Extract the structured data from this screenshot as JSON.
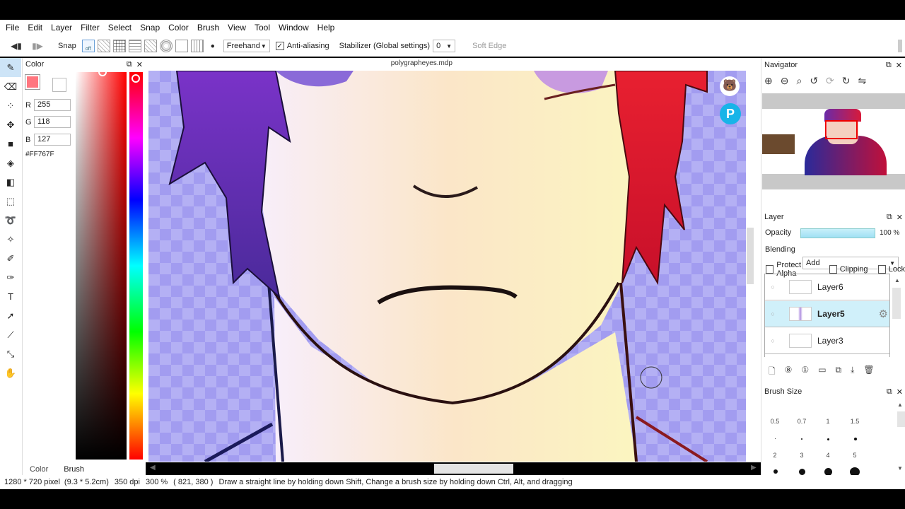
{
  "menu": [
    "File",
    "Edit",
    "Layer",
    "Filter",
    "Select",
    "Snap",
    "Color",
    "Brush",
    "View",
    "Tool",
    "Window",
    "Help"
  ],
  "toolbar": {
    "snap_label": "Snap",
    "snap_off_label": "off",
    "brush_mode": "Freehand",
    "antialias_label": "Anti-aliasing",
    "stabilizer_label": "Stabilizer (Global settings)",
    "stabilizer_value": "0",
    "soft_edge_label": "Soft Edge"
  },
  "color_panel": {
    "title": "Color",
    "r_label": "R",
    "r_value": "255",
    "g_label": "G",
    "g_value": "118",
    "b_label": "B",
    "b_value": "127",
    "hex": "#FF767F",
    "fg_color": "#FF767F",
    "bg_color": "#FFFFFF"
  },
  "bottom_tabs": {
    "color": "Color",
    "brush": "Brush"
  },
  "document": {
    "title": "polygrapheyes.mdp"
  },
  "navigator": {
    "title": "Navigator"
  },
  "layer_panel": {
    "title": "Layer",
    "opacity_label": "Opacity",
    "opacity_value": "100 %",
    "opacity_fraction": 1.0,
    "blending_label": "Blending",
    "blending_value": "Add",
    "protect_alpha": "Protect Alpha",
    "clipping": "Clipping",
    "lock": "Lock",
    "layers": [
      {
        "name": "Layer6",
        "selected": false
      },
      {
        "name": "Layer5",
        "selected": true
      },
      {
        "name": "Layer3",
        "selected": false
      }
    ]
  },
  "brush_size": {
    "title": "Brush Size",
    "sizes_row1": [
      "0.5",
      "0.7",
      "1",
      "1.5"
    ],
    "sizes_row2": [
      "2",
      "3",
      "4",
      "5"
    ]
  },
  "status": {
    "canvas_size": "1280 * 720 pixel",
    "physical_size": "(9.3 * 5.2cm)",
    "dpi": "350 dpi",
    "zoom": "300 %",
    "cursor": "( 821, 380 )",
    "hint": "Draw a straight line by holding down Shift, Change a brush size by holding down Ctrl, Alt, and dragging"
  }
}
